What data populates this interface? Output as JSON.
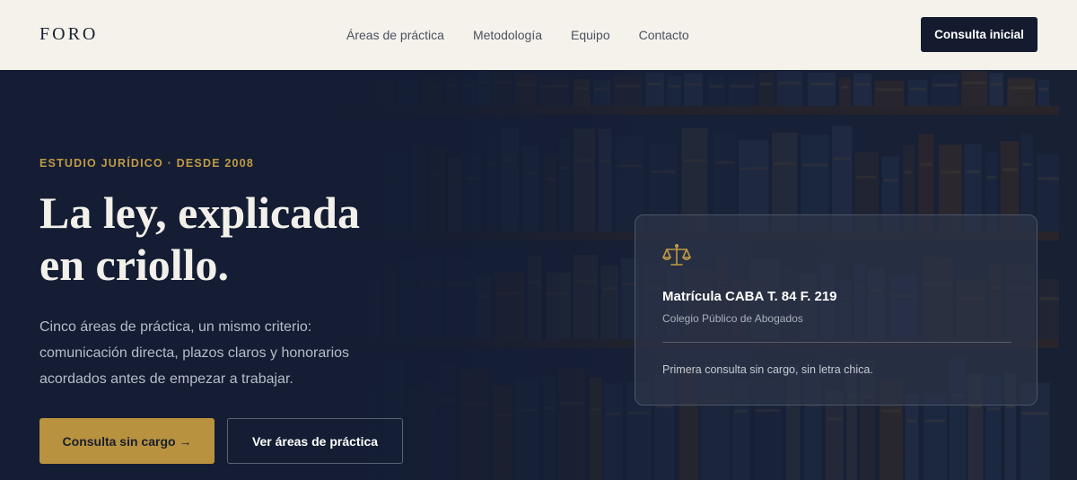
{
  "header": {
    "brand": "FORO",
    "nav": [
      "Áreas de práctica",
      "Metodología",
      "Equipo",
      "Contacto"
    ],
    "cta": "Consulta inicial"
  },
  "hero": {
    "eyebrow": "ESTUDIO JURÍDICO · DESDE 2008",
    "headline_line1": "La ley, explicada",
    "headline_line2": "en criollo.",
    "lead": "Cinco áreas de práctica, un mismo criterio: comunicación directa, plazos claros y honorarios acordados antes de empezar a trabajar.",
    "primary_button": "Consulta sin cargo →",
    "secondary_button": "Ver áreas de práctica"
  },
  "card": {
    "icon": "scales-icon",
    "title": "Matrícula CABA T. 84 F. 219",
    "subtitle": "Colegio Público de Abogados",
    "note": "Primera consulta sin cargo, sin letra chica."
  },
  "colors": {
    "accent": "#b8923f",
    "navy": "#141d33",
    "header_bg": "#f5f2ec"
  }
}
